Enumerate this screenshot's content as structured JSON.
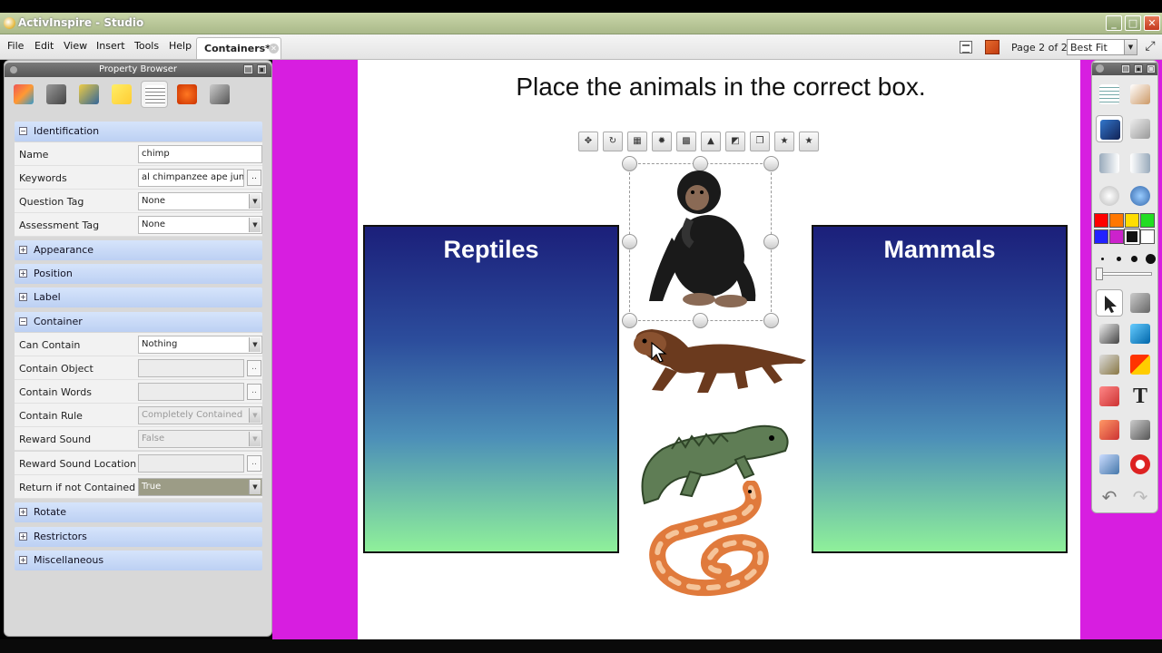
{
  "window": {
    "title": "ActivInspire - Studio"
  },
  "menu": {
    "items": [
      "File",
      "Edit",
      "View",
      "Insert",
      "Tools",
      "Help"
    ]
  },
  "doc_tab": {
    "label": "Containers*"
  },
  "page_nav": {
    "label": "Page 2 of 2",
    "zoom": "Best Fit"
  },
  "property_browser": {
    "title": "Property Browser",
    "sections": {
      "identification": "Identification",
      "appearance": "Appearance",
      "position": "Position",
      "label": "Label",
      "container": "Container",
      "rotate": "Rotate",
      "restrictors": "Restrictors",
      "miscellaneous": "Miscellaneous"
    },
    "identification": {
      "name": {
        "key": "Name",
        "value": "chimp"
      },
      "keywords": {
        "key": "Keywords",
        "value": "al chimpanzee ape jungle"
      },
      "question_tag": {
        "key": "Question Tag",
        "value": "None"
      },
      "assessment_tag": {
        "key": "Assessment Tag",
        "value": "None"
      }
    },
    "container": {
      "can_contain": {
        "key": "Can Contain",
        "value": "Nothing"
      },
      "contain_object": {
        "key": "Contain Object",
        "value": ""
      },
      "contain_words": {
        "key": "Contain Words",
        "value": ""
      },
      "contain_rule": {
        "key": "Contain Rule",
        "value": "Completely Contained"
      },
      "reward_sound": {
        "key": "Reward Sound",
        "value": "False"
      },
      "reward_sound_location": {
        "key": "Reward Sound Location",
        "value": ""
      },
      "return_if_not_contained": {
        "key": "Return if not Contained",
        "value": "True"
      }
    }
  },
  "flipchart": {
    "instruction": "Place the animals in the correct box.",
    "box_left_title": "Reptiles",
    "box_right_title": "Mammals",
    "animals": [
      "chimp",
      "ferret",
      "iguana",
      "snake"
    ]
  },
  "colors": {
    "purple_frame": "#d71ee0",
    "palette": [
      "#ff0000",
      "#ff7700",
      "#ffdd00",
      "#22dd22",
      "#2222ff",
      "#cc22cc",
      "#111111",
      "#ffffff"
    ]
  }
}
